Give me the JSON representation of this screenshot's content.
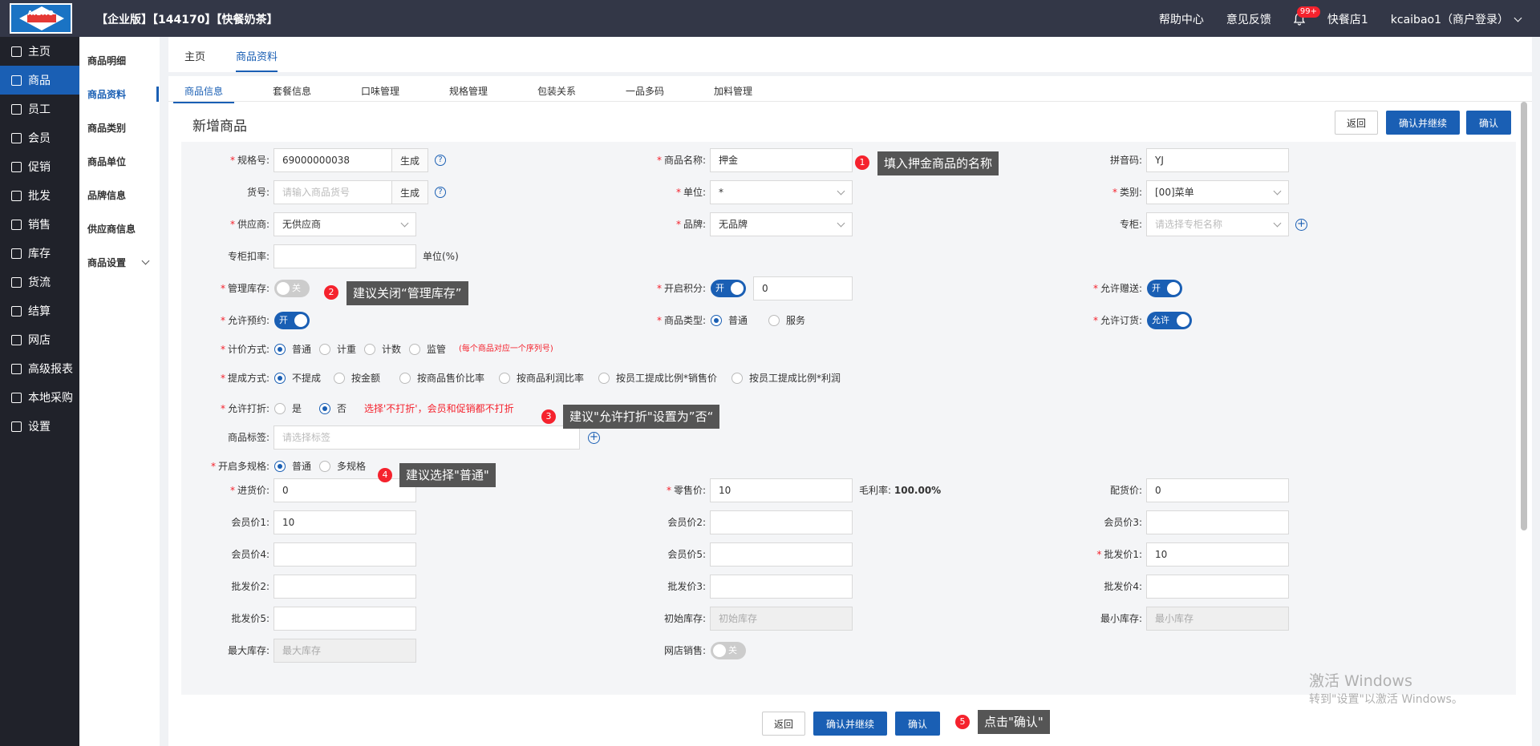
{
  "header": {
    "logo_text": "AIBAO",
    "title": "【企业版】【144170】【快餐奶茶】",
    "help": "帮助中心",
    "feedback": "意见反馈",
    "notif_badge": "99+",
    "store": "快餐店1",
    "user": "kcaibao1（商户登录）"
  },
  "sidebar": {
    "items": [
      {
        "label": "主页",
        "icon": "home-icon"
      },
      {
        "label": "商品",
        "icon": "goods-icon"
      },
      {
        "label": "员工",
        "icon": "staff-icon"
      },
      {
        "label": "会员",
        "icon": "member-icon"
      },
      {
        "label": "促销",
        "icon": "promo-icon"
      },
      {
        "label": "批发",
        "icon": "wholesale-icon"
      },
      {
        "label": "销售",
        "icon": "sales-icon"
      },
      {
        "label": "库存",
        "icon": "stock-icon"
      },
      {
        "label": "货流",
        "icon": "flow-icon"
      },
      {
        "label": "结算",
        "icon": "settle-icon"
      },
      {
        "label": "网店",
        "icon": "shop-icon"
      },
      {
        "label": "高级报表",
        "icon": "report-icon"
      },
      {
        "label": "本地采购",
        "icon": "purchase-icon"
      },
      {
        "label": "设置",
        "icon": "gear-icon"
      }
    ],
    "active_index": 1
  },
  "subnav": {
    "items": [
      "商品明细",
      "商品资料",
      "商品类别",
      "商品单位",
      "品牌信息",
      "供应商信息",
      "商品设置"
    ]
  },
  "tabs": [
    "主页",
    "商品资料"
  ],
  "subtabs": [
    "商品信息",
    "套餐信息",
    "口味管理",
    "规格管理",
    "包装关系",
    "一品多码",
    "加料管理"
  ],
  "page": {
    "title": "新增商品",
    "btn_back": "返回",
    "btn_confirm_continue": "确认并继续",
    "btn_confirm": "确认"
  },
  "form": {
    "barcode": {
      "label": "规格号:",
      "value": "69000000038",
      "gen": "生成"
    },
    "itemno": {
      "label": "货号:",
      "placeholder": "请输入商品货号",
      "gen": "生成"
    },
    "supplier": {
      "label": "供应商:",
      "value": "无供应商"
    },
    "counter_rate": {
      "label": "专柜扣率:",
      "unit": "单位(%)"
    },
    "manage_stock": {
      "label": "管理库存:",
      "state": "关"
    },
    "allow_reserve": {
      "label": "允许预约:",
      "state": "开"
    },
    "pricing": {
      "label": "计价方式:",
      "options": [
        "普通",
        "计重",
        "计数",
        "监管"
      ],
      "note": "(每个商品对应一个序列号)"
    },
    "commission": {
      "label": "提成方式:",
      "options": [
        "不提成",
        "按金额",
        "按商品售价比率",
        "按商品利润比率",
        "按员工提成比例*销售价",
        "按员工提成比例*利润"
      ]
    },
    "discount": {
      "label": "允许打折:",
      "options": [
        "是",
        "否"
      ],
      "note": "选择'不打折'，会员和促销都不打折"
    },
    "tags": {
      "label": "商品标签:",
      "placeholder": "请选择标签"
    },
    "multi_spec": {
      "label": "开启多规格:",
      "options": [
        "普通",
        "多规格"
      ]
    },
    "name": {
      "label": "商品名称:",
      "value": "押金"
    },
    "unit": {
      "label": "单位:",
      "value": "*"
    },
    "brand": {
      "label": "品牌:",
      "value": "无品牌"
    },
    "points": {
      "label": "开启积分:",
      "state": "开",
      "value": "0"
    },
    "type": {
      "label": "商品类型:",
      "options": [
        "普通",
        "服务"
      ]
    },
    "pinyin": {
      "label": "拼音码:",
      "value": "YJ"
    },
    "category": {
      "label": "类别:",
      "value": "[00]菜单"
    },
    "counter": {
      "label": "专柜:",
      "placeholder": "请选择专柜名称"
    },
    "allow_gift": {
      "label": "允许赠送:",
      "state": "开"
    },
    "allow_order": {
      "label": "允许订货:",
      "state": "允许"
    },
    "cost": {
      "label": "进货价:",
      "value": "0"
    },
    "retail": {
      "label": "零售价:",
      "value": "10"
    },
    "margin": {
      "label": "毛利率:",
      "value": "100.00%"
    },
    "dist": {
      "label": "配货价:",
      "value": "0"
    },
    "vip1": {
      "label": "会员价1:",
      "value": "10"
    },
    "vip2": {
      "label": "会员价2:",
      "value": ""
    },
    "vip3": {
      "label": "会员价3:",
      "value": ""
    },
    "vip4": {
      "label": "会员价4:",
      "value": ""
    },
    "vip5": {
      "label": "会员价5:",
      "value": ""
    },
    "ws1": {
      "label": "批发价1:",
      "value": "10"
    },
    "ws2": {
      "label": "批发价2:",
      "value": ""
    },
    "ws3": {
      "label": "批发价3:",
      "value": ""
    },
    "ws4": {
      "label": "批发价4:",
      "value": ""
    },
    "ws5": {
      "label": "批发价5:",
      "value": ""
    },
    "init_stock": {
      "label": "初始库存:",
      "placeholder": "初始库存"
    },
    "min_stock": {
      "label": "最小库存:",
      "placeholder": "最小库存"
    },
    "max_stock": {
      "label": "最大库存:",
      "placeholder": "最大库存"
    },
    "online": {
      "label": "网店销售:",
      "state": "关"
    }
  },
  "tips": [
    {
      "num": "1",
      "text": "填入押金商品的名称"
    },
    {
      "num": "2",
      "text": "建议关闭“管理库存”"
    },
    {
      "num": "3",
      "text": "建议\"允许打折\"设置为”否“"
    },
    {
      "num": "4",
      "text": "建议选择\"普通\""
    },
    {
      "num": "5",
      "text": "点击\"确认\""
    }
  ],
  "watermark": {
    "line1": "激活 Windows",
    "line2": "转到\"设置\"以激活 Windows。"
  }
}
